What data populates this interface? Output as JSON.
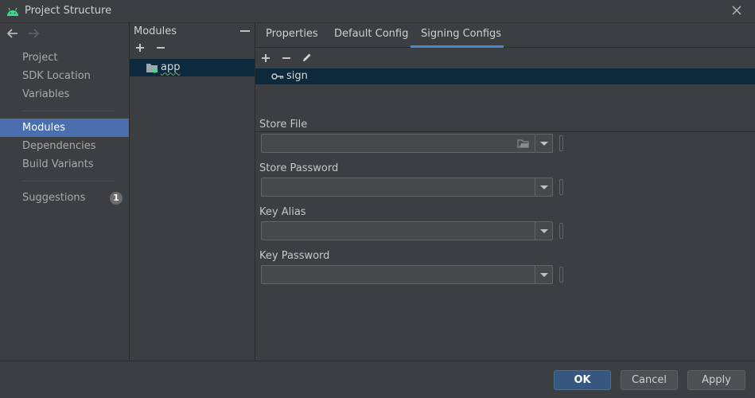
{
  "window": {
    "title": "Project Structure"
  },
  "sidebar": {
    "items": [
      {
        "label": "Project"
      },
      {
        "label": "SDK Location"
      },
      {
        "label": "Variables"
      },
      {
        "label": "Modules"
      },
      {
        "label": "Dependencies"
      },
      {
        "label": "Build Variants"
      },
      {
        "label": "Suggestions",
        "badge": "1"
      }
    ],
    "selected": "Modules"
  },
  "modules": {
    "header": "Modules",
    "items": [
      {
        "label": "app"
      }
    ]
  },
  "tabs": [
    {
      "label": "Properties"
    },
    {
      "label": "Default Config"
    },
    {
      "label": "Signing Configs",
      "active": true
    }
  ],
  "signing_configs": {
    "items": [
      {
        "label": "sign"
      }
    ]
  },
  "form": {
    "fields": [
      {
        "label": "Store File",
        "value": ""
      },
      {
        "label": "Store Password",
        "value": ""
      },
      {
        "label": "Key Alias",
        "value": ""
      },
      {
        "label": "Key Password",
        "value": ""
      }
    ]
  },
  "footer": {
    "ok_label": "OK",
    "cancel_label": "Cancel",
    "apply_label": "Apply"
  },
  "colors": {
    "background": "#3c3f41",
    "selection": "#4b6eaf",
    "row_selection": "#0d293e",
    "accent_tab": "#4a88c7",
    "android_green": "#3ddc84"
  }
}
